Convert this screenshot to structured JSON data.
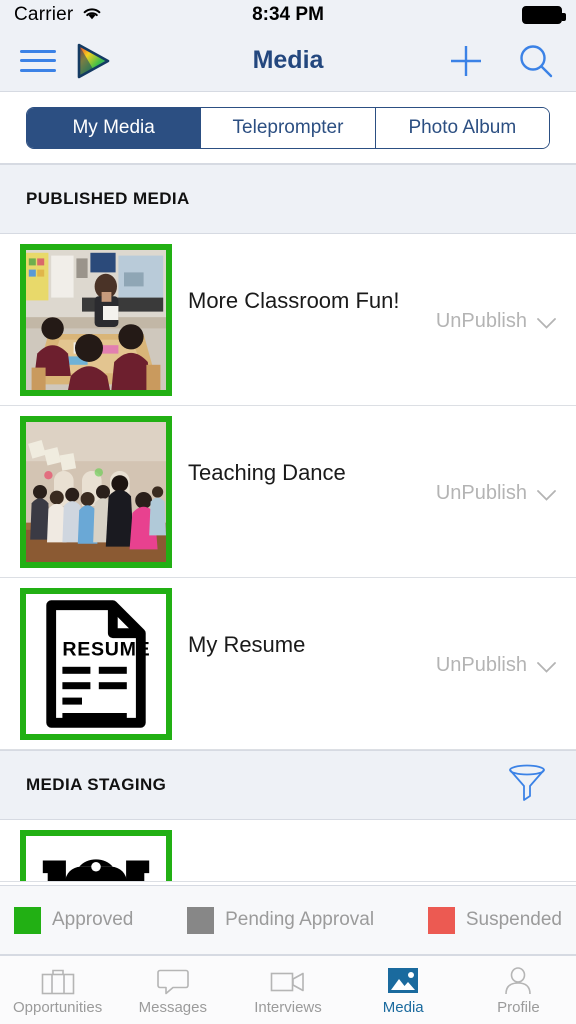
{
  "status_bar": {
    "carrier": "Carrier",
    "wifi_icon": "wifi-icon",
    "time": "8:34 PM",
    "battery_icon": "battery-full-icon"
  },
  "nav_bar": {
    "menu_icon": "hamburger-menu-icon",
    "logo_icon": "app-logo-play-triangle-icon",
    "title": "Media",
    "add_icon": "plus-icon",
    "search_icon": "search-icon"
  },
  "segmented_control": {
    "tabs": [
      {
        "label": "My Media",
        "active": true
      },
      {
        "label": "Teleprompter",
        "active": false
      },
      {
        "label": "Photo Album",
        "active": false
      }
    ]
  },
  "sections": [
    {
      "title": "PUBLISHED MEDIA",
      "has_filter": false,
      "items": [
        {
          "title": "More Classroom Fun!",
          "action_label": "UnPublish",
          "chevron_icon": "chevron-down-icon",
          "thumbnail": "classroom-photo-thumbnail",
          "status_color": "#22b014"
        },
        {
          "title": "Teaching Dance",
          "action_label": "UnPublish",
          "chevron_icon": "chevron-down-icon",
          "thumbnail": "dance-hall-photo-thumbnail",
          "status_color": "#22b014"
        },
        {
          "title": "My Resume",
          "action_label": "UnPublish",
          "chevron_icon": "chevron-down-icon",
          "thumbnail": "resume-document-icon",
          "thumbnail_text": "RESUME",
          "status_color": "#22b014"
        }
      ]
    },
    {
      "title": "MEDIA STAGING",
      "has_filter": true,
      "filter_icon": "funnel-filter-icon",
      "items": [
        {
          "thumbnail": "photo-placeholder-icon",
          "status_color": "#22b014"
        }
      ]
    }
  ],
  "legend": [
    {
      "label": "Approved",
      "color": "#22b014"
    },
    {
      "label": "Pending  Approval",
      "color": "#878787"
    },
    {
      "label": "Suspended",
      "color": "#ec5a52"
    }
  ],
  "tab_bar": {
    "active_color": "#1a6a9e",
    "inactive_color": "#9b9b9b",
    "tabs": [
      {
        "label": "Opportunities",
        "icon": "briefcase-icon",
        "active": false
      },
      {
        "label": "Messages",
        "icon": "chat-bubble-icon",
        "active": false
      },
      {
        "label": "Interviews",
        "icon": "video-camera-icon",
        "active": false
      },
      {
        "label": "Media",
        "icon": "image-icon",
        "active": true
      },
      {
        "label": "Profile",
        "icon": "person-icon",
        "active": false
      }
    ]
  }
}
